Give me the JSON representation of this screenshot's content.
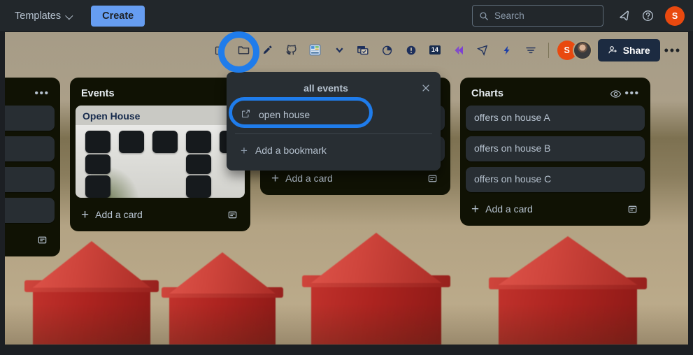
{
  "appbar": {
    "templates_label": "Templates",
    "create_label": "Create",
    "search_placeholder": "Search",
    "notifications_icon": "notification-bell-icon",
    "help_icon": "help-circle-icon",
    "avatar_initial": "S",
    "avatar_color": "#e9490f"
  },
  "board_toolbar": {
    "icons": [
      {
        "name": "external-link-icon",
        "glyph": "open-in-new"
      },
      {
        "name": "folder-icon",
        "glyph": "folder"
      },
      {
        "name": "pen-icon",
        "glyph": "pen"
      },
      {
        "name": "github-icon",
        "glyph": "github"
      },
      {
        "name": "dashboard-app-icon",
        "glyph": "dashboard"
      },
      {
        "name": "chevron-down-icon",
        "glyph": "chevron-down"
      },
      {
        "name": "window-check-icon",
        "glyph": "window-check"
      },
      {
        "name": "pie-chart-icon",
        "glyph": "pie"
      },
      {
        "name": "info-circle-icon",
        "glyph": "info"
      },
      {
        "name": "calendar-14-icon",
        "glyph": "14"
      },
      {
        "name": "chevrons-left-icon",
        "glyph": "double-chevron"
      },
      {
        "name": "send-plane-icon",
        "glyph": "send"
      },
      {
        "name": "lightning-bolt-icon",
        "glyph": "bolt"
      },
      {
        "name": "filter-icon",
        "glyph": "filter"
      }
    ],
    "badge_14": "14",
    "members": [
      {
        "initial": "S",
        "color": "#e9490f"
      },
      {
        "initial": "",
        "color": "#3a3a3c"
      }
    ],
    "share_label": "Share",
    "more_label": "..."
  },
  "popup": {
    "title": "all events",
    "close_icon": "close-icon",
    "bookmark_label": "open house",
    "bookmark_icon": "external-link-icon",
    "add_bookmark_label": "Add a bookmark",
    "add_icon": "plus-icon",
    "highlight_color": "#1f7ceb"
  },
  "lists": [
    {
      "name": "list-partial-left",
      "title": "",
      "title_visible": false,
      "has_watch_icon": false,
      "cards": [
        "",
        "",
        "",
        ""
      ],
      "card_type": "empty",
      "add_card_label": "",
      "add_card_visible": false,
      "template_icon": "card-template-icon"
    },
    {
      "name": "list-events",
      "title": "Events",
      "title_visible": true,
      "has_watch_icon": false,
      "cover_card": {
        "title": "Open House",
        "image_alt": "room-interior-photo"
      },
      "cards": [],
      "add_card_label": "Add a card",
      "add_card_visible": true,
      "template_icon": "card-template-icon"
    },
    {
      "name": "list-hidden-behind-popup",
      "title": "",
      "title_visible": false,
      "has_watch_icon": false,
      "cards": [
        "",
        ""
      ],
      "card_type": "empty",
      "add_card_label": "Add a card",
      "add_card_visible": true,
      "template_icon": "card-template-icon"
    },
    {
      "name": "list-charts",
      "title": "Charts",
      "title_visible": true,
      "has_watch_icon": true,
      "watch_icon": "eye-icon",
      "cards": [
        "offers on house A",
        "offers on house B",
        "offers on house C"
      ],
      "card_type": "text",
      "add_card_label": "Add a card",
      "add_card_visible": true,
      "template_icon": "card-template-icon"
    }
  ],
  "background": {
    "description": "red wooden toy houses on a wooden desk",
    "accent": "#ad2420"
  }
}
